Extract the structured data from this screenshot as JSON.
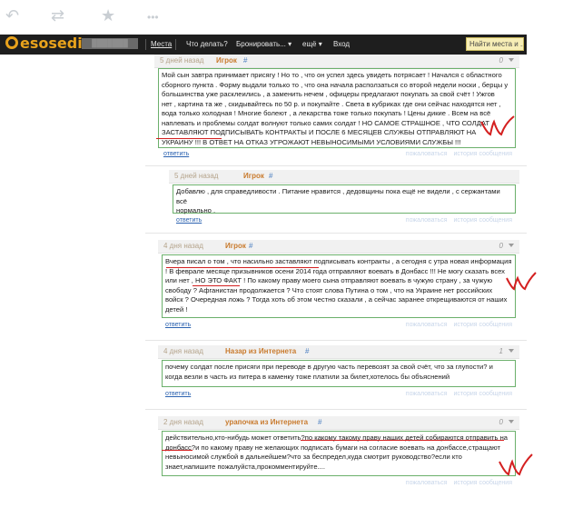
{
  "tweet_actions": [
    {
      "icon": "reply-icon",
      "glyph": "↶"
    },
    {
      "icon": "retweet-icon",
      "glyph": "⇄"
    },
    {
      "icon": "favorite-icon",
      "glyph": "★"
    },
    {
      "icon": "more-icon",
      "glyph": "•••"
    }
  ],
  "header": {
    "logo": "esosedi",
    "user_block": "███████",
    "nav": [
      "Места",
      "Что делать?",
      "Бронировать... ▾",
      "ещё ▾",
      "Вход"
    ],
    "search_placeholder": "Найти места и ..."
  },
  "comments": [
    {
      "date": "5 дней назад",
      "author": "Игрок",
      "hash": "#",
      "vote": "0",
      "lines": [
        "Мой сын завтра принимает присягу ! Но то , что он успел здесь увидеть потрясает ! Начался с областного",
        "сборного пункта . Форму выдали только то , что она начала расползаться со второй недели носки , берцы у",
        "большинства уже расклеились , а заменить нечем , офицеры предлагают покупать за свой счёт ! Ужгов",
        "нет , картина та же , скидывайтесь по 50 р. и покупайте . Света в кубриках где они сейчас находятся нет ,",
        "вода только холодная ! Многие болеют , а лекарства тоже только покупать ! Цены дикие . Всем на всё",
        "наплевать и проблемы солдат волнуют только самих солдат ! НО САМОЕ СТРАШНОЕ , ЧТО СОЛДАТ",
        "ЗАСТАВЛЯЮТ ПОДПИСЫВАТЬ КОНТРАКТЫ И ПОСЛЕ 6 МЕСЯЦЕВ СЛУЖБЫ ОТПРАВЛЯЮТ НА",
        "УКРАИНУ !!! В ОТВЕТ НА ОТКАЗ УГРОЖАЮТ НЕВЫНОСИМЫМИ УСЛОВИЯМИ СЛУЖБЫ !!!"
      ],
      "reply": "ответить",
      "links": [
        "пожаловаться",
        "история сообщения"
      ]
    },
    {
      "date": "5 дней назад",
      "author": "Игрок",
      "hash": "#",
      "vote": "0",
      "lines": [
        "Добавлю , для справедливости . Питание нравится , дедовщины пока ещё не видели , с сержантами всё",
        "нормально ."
      ],
      "reply": "ответить",
      "links": [
        "пожаловаться",
        "история сообщения"
      ]
    },
    {
      "date": "4 дня назад",
      "author": "Игрок",
      "hash": "#",
      "vote": "0",
      "lines": [
        "Вчера писал о том , что насильно заставляют подписывать контракты , а сегодня с утра новая информация",
        "! В феврале месяце призывников осени 2014 года отправляют воевать в Донбасс !!! Не могу сказать всех",
        "или нет , НО ЭТО ФАКТ ! По какому праву моего сына отправляют воевать в чужую страну , за чужую",
        "свободу ? Афганистан продолжается ? Что стоят слова Путина о том , что на Украине нет российских",
        "войск ? Очередная ложь ? Тогда хоть об этом честно сказали , а сейчас заранее открещиваются от наших",
        "детей !"
      ],
      "reply": "ответить",
      "links": [
        "пожаловаться",
        "история сообщения"
      ]
    },
    {
      "date": "4 дня назад",
      "author": "Назар из Интернета",
      "hash": "#",
      "vote": "1",
      "lines": [
        "почему солдат после присяги при переводе в другую часть перевозят за свой счёт, что за глупости? и",
        "когда везли в часть из питера в каменку тоже платили за билет,хотелось бы объяснений"
      ],
      "reply": "ответить",
      "links": [
        "пожаловаться",
        "история сообщения"
      ]
    },
    {
      "date": "2 дня назад",
      "author": "урапочка из Интернета",
      "hash": "#",
      "vote": "0",
      "lines": [
        "действительно,кто-нибудь может ответить?по какому такому праву наших детей собираются отправить на",
        "донбасс?и по какому праву не желающих подписать бумаги на согласие воевать на донбассе,стращают",
        "невыносимой службой в дальнейшем?что за беспредел,куда смотрит руководство?если кто",
        "знает,напишите пожалуйста,прокомментируйте...."
      ],
      "reply": "ответить",
      "links": [
        "пожаловаться",
        "история сообщения"
      ]
    }
  ]
}
